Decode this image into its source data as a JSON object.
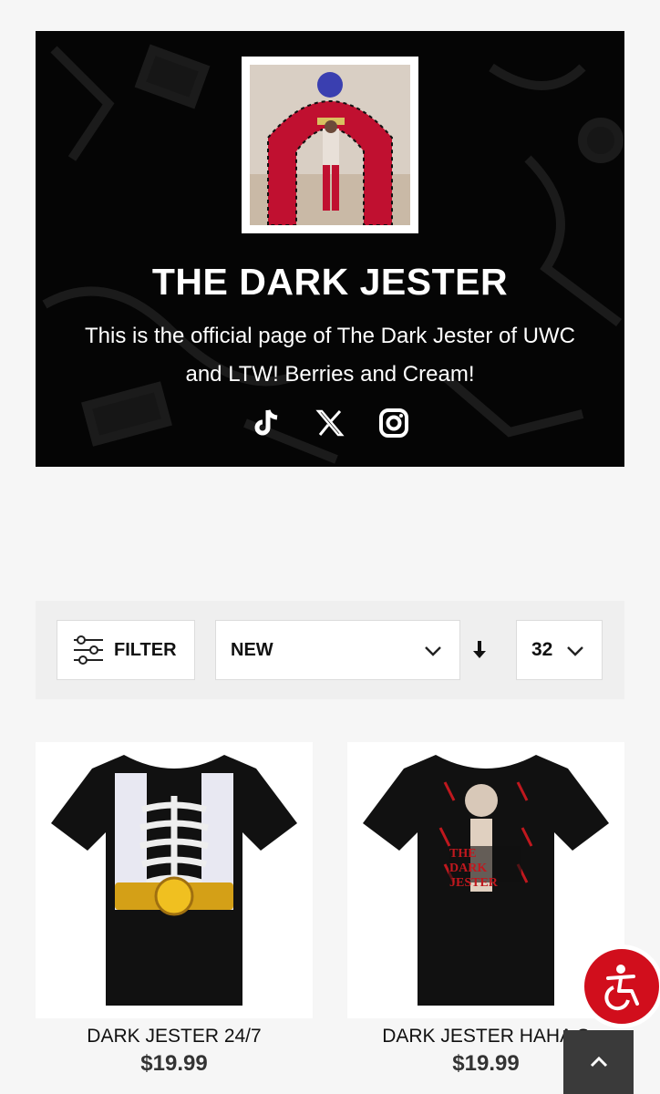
{
  "hero": {
    "title": "THE DARK JESTER",
    "description": "This is the official page of The Dark Jester of UWC and LTW! Berries and Cream!",
    "socials": [
      "tiktok",
      "x",
      "instagram"
    ]
  },
  "toolbar": {
    "filter_label": "FILTER",
    "sort_value": "NEW",
    "per_page_value": "32"
  },
  "products": [
    {
      "name": "DARK JESTER 24/7",
      "price": "$19.99"
    },
    {
      "name": "DARK JESTER HAHA S",
      "price": "$19.99"
    }
  ],
  "colors": {
    "accent": "#d10e1c",
    "hero_bg": "#050505",
    "page_bg": "#f6f6f6"
  }
}
